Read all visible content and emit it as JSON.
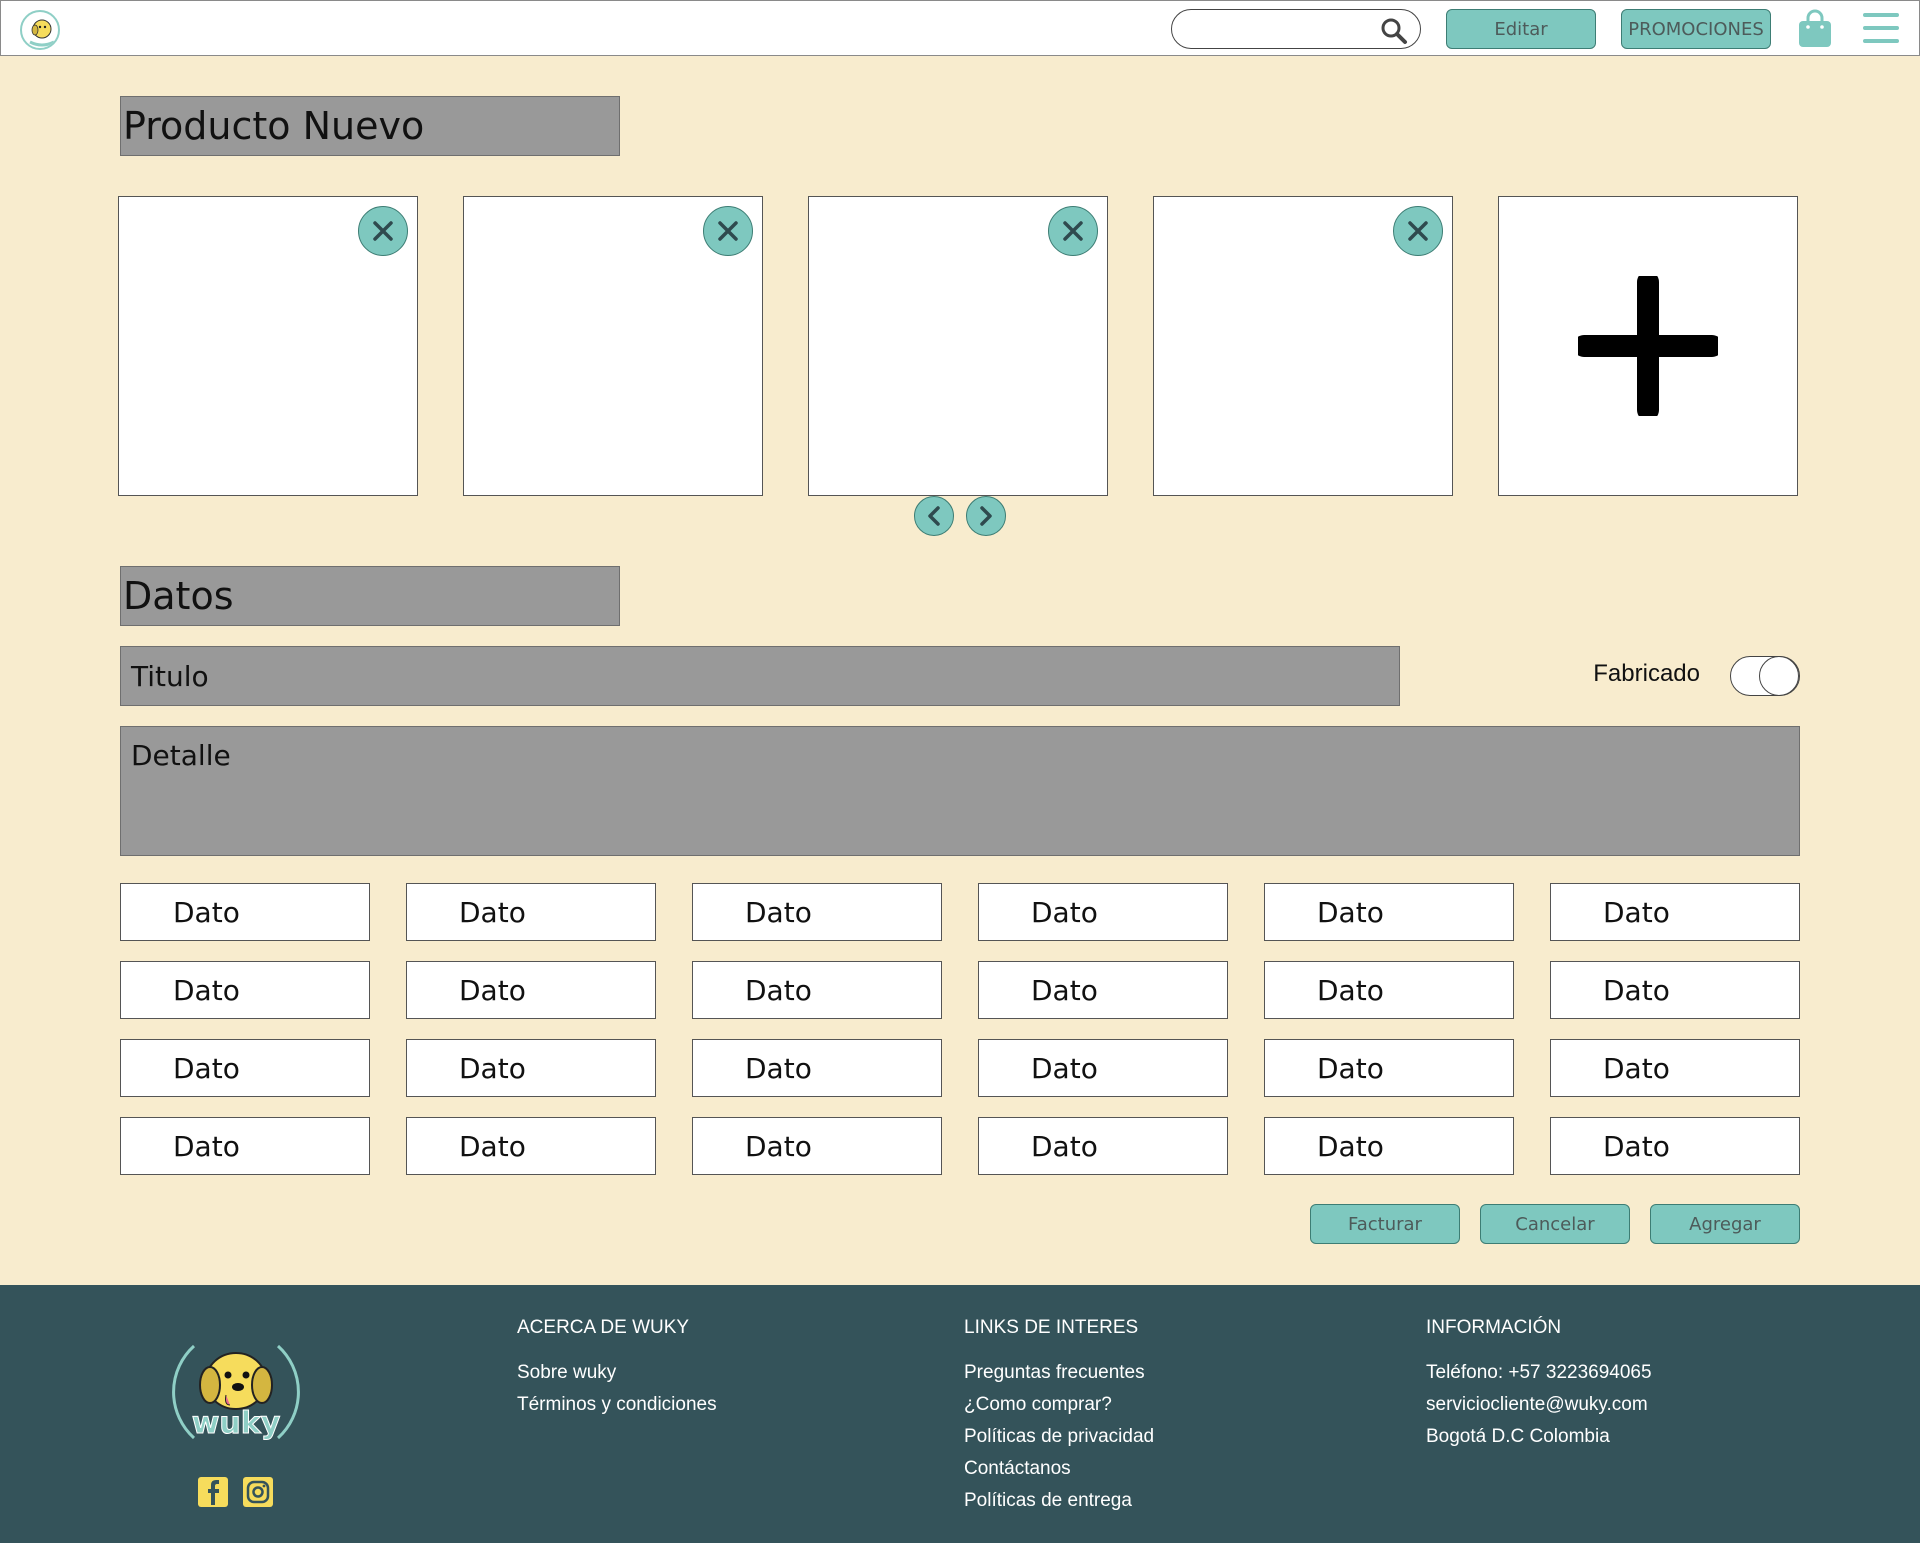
{
  "header": {
    "search_placeholder": "",
    "editar_label": "Editar",
    "promociones_label": "PROMOCIONES"
  },
  "main": {
    "title": "Producto Nuevo",
    "datos_title": "Datos",
    "titulo_placeholder": "Titulo",
    "fabricado_label": "Fabricado",
    "detalle_placeholder": "Detalle",
    "dato_label": "Dato",
    "buttons": {
      "facturar": "Facturar",
      "cancelar": "Cancelar",
      "agregar": "Agregar"
    }
  },
  "footer": {
    "brand": "wuky",
    "about": {
      "heading": "ACERCA DE WUKY",
      "links": [
        "Sobre wuky",
        "Términos y condiciones"
      ]
    },
    "links": {
      "heading": "LINKS DE INTERES",
      "items": [
        "Preguntas frecuentes",
        "¿Como comprar?",
        "Políticas de privacidad",
        "Contáctanos",
        "Políticas de entrega"
      ]
    },
    "info": {
      "heading": "INFORMACIÓN",
      "items": [
        "Teléfono: +57 3223694065",
        "serviciocliente@wuky.com",
        "Bogotá D.C Colombia"
      ]
    }
  },
  "colors": {
    "page_bg": "#f8ecce",
    "accent": "#7ec8bf",
    "footer_bg": "#34535a",
    "field_gray": "#999999"
  },
  "icons": [
    "search-icon",
    "shopping-bag-icon",
    "hamburger-menu-icon",
    "close-icon",
    "plus-icon",
    "chevron-left-icon",
    "chevron-right-icon",
    "facebook-icon",
    "instagram-icon"
  ]
}
